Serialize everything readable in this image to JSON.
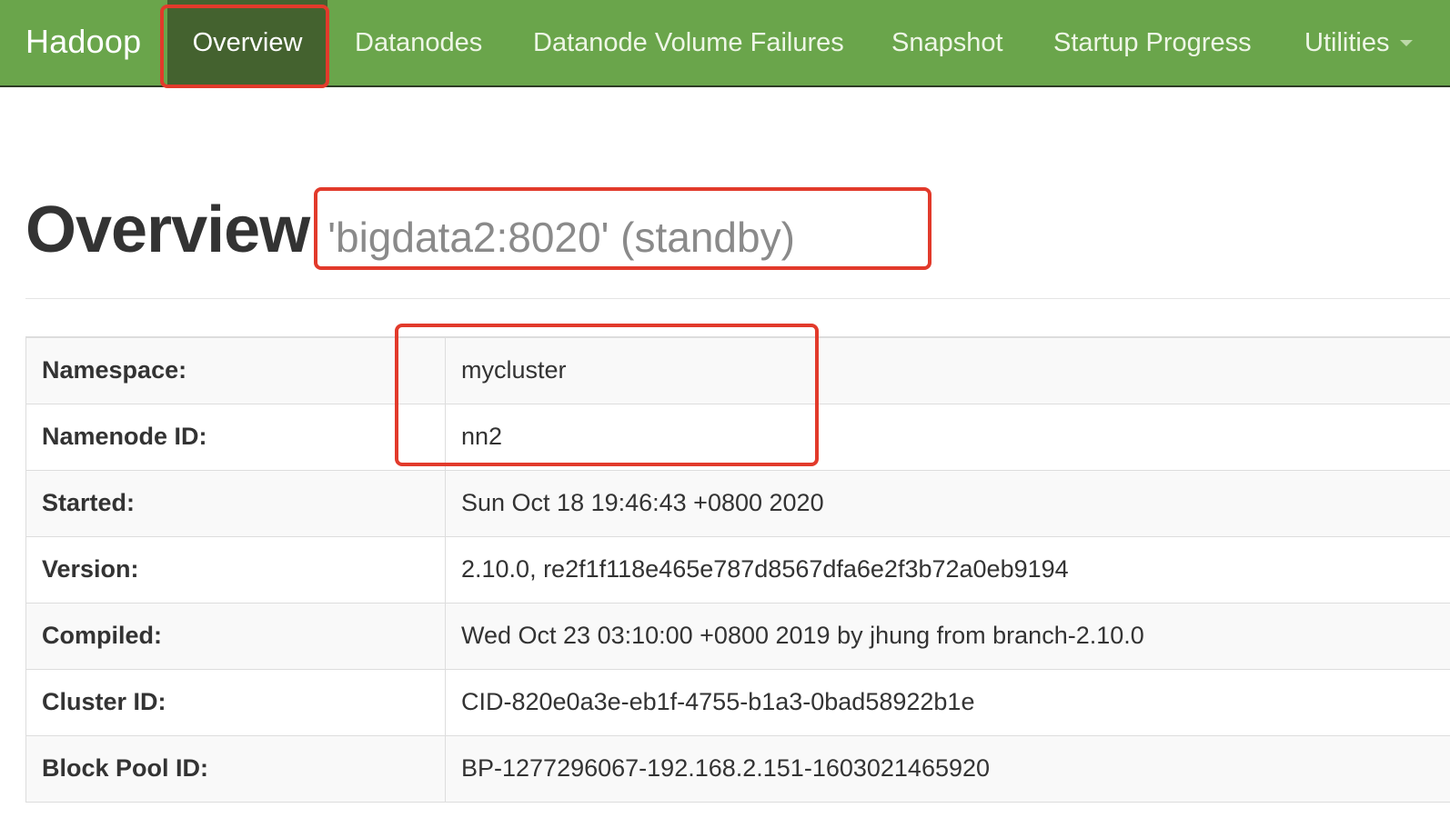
{
  "navbar": {
    "brand": "Hadoop",
    "items": [
      {
        "label": "Overview",
        "active": true
      },
      {
        "label": "Datanodes"
      },
      {
        "label": "Datanode Volume Failures"
      },
      {
        "label": "Snapshot"
      },
      {
        "label": "Startup Progress"
      },
      {
        "label": "Utilities",
        "has_dropdown": true
      }
    ]
  },
  "page": {
    "title": "Overview",
    "subtitle": "'bigdata2:8020' (standby)"
  },
  "info_rows": [
    {
      "label": "Namespace:",
      "value": "mycluster"
    },
    {
      "label": "Namenode ID:",
      "value": "nn2"
    },
    {
      "label": "Started:",
      "value": "Sun Oct 18 19:46:43 +0800 2020"
    },
    {
      "label": "Version:",
      "value": "2.10.0, re2f1f118e465e787d8567dfa6e2f3b72a0eb9194"
    },
    {
      "label": "Compiled:",
      "value": "Wed Oct 23 03:10:00 +0800 2019 by jhung from branch-2.10.0"
    },
    {
      "label": "Cluster ID:",
      "value": "CID-820e0a3e-eb1f-4755-b1a3-0bad58922b1e"
    },
    {
      "label": "Block Pool ID:",
      "value": "BP-1277296067-192.168.2.151-1603021465920"
    }
  ],
  "colors": {
    "navbar_bg": "#6aa54b",
    "navbar_active_bg": "#44622f",
    "annotation": "#e23a2b"
  }
}
